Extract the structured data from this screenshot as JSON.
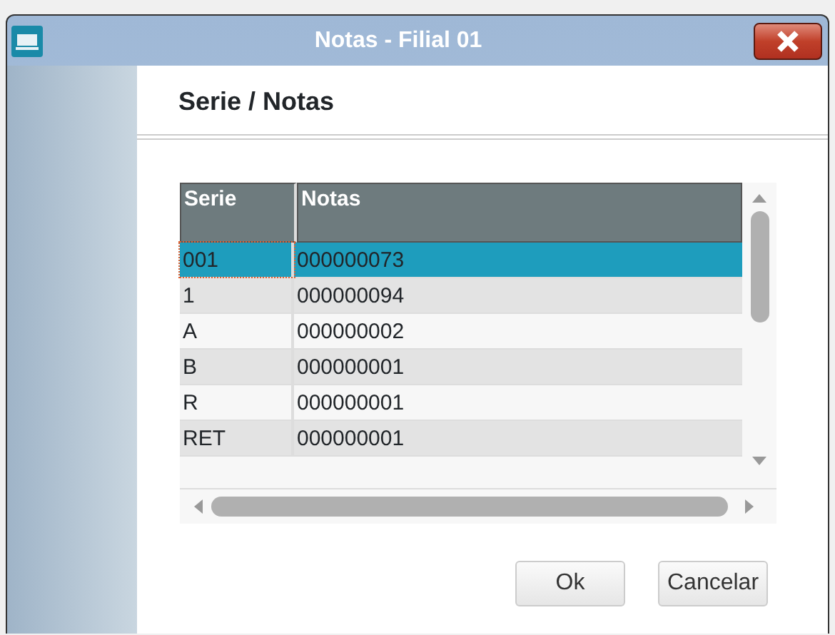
{
  "window": {
    "title": "Notas - Filial 01"
  },
  "heading": "Serie / Notas",
  "table": {
    "columns": [
      "Serie",
      "Notas"
    ],
    "rows": [
      {
        "cells": [
          "001",
          "000000073"
        ],
        "selected": true
      },
      {
        "cells": [
          "1",
          "000000094"
        ],
        "selected": false
      },
      {
        "cells": [
          "A",
          "000000002"
        ],
        "selected": false
      },
      {
        "cells": [
          "B",
          "000000001"
        ],
        "selected": false
      },
      {
        "cells": [
          "R",
          "000000001"
        ],
        "selected": false
      },
      {
        "cells": [
          "RET",
          "000000001"
        ],
        "selected": false
      }
    ]
  },
  "buttons": [
    "Ok",
    "Cancelar"
  ]
}
